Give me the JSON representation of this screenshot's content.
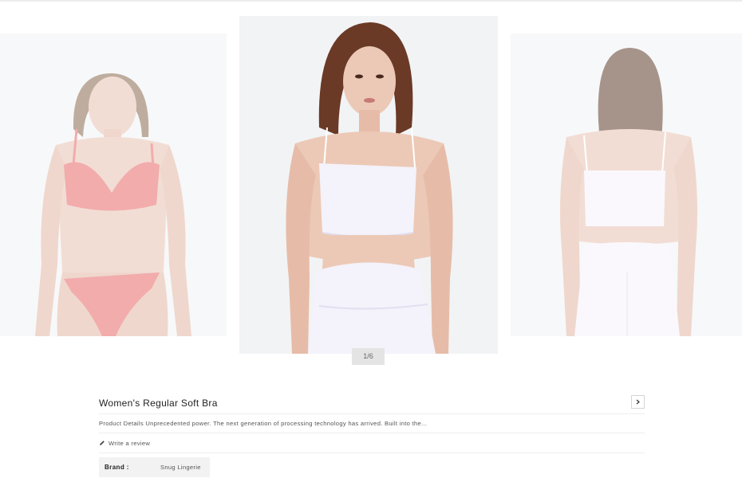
{
  "carousel": {
    "counter": "1/6",
    "slides": [
      {
        "position": "previous",
        "subject": "model in red lace bra and panty"
      },
      {
        "position": "current",
        "subject": "model in white tube bra and leggings"
      },
      {
        "position": "next",
        "subject": "back view of white tube bra and leggings"
      }
    ]
  },
  "product": {
    "title": "Women's Regular Soft Bra",
    "description": "Product Details Unprecedented power. The next generation of processing technology has arrived. Built into the...",
    "review_link": "Write a review",
    "brand_label": "Brand :",
    "brand_value": "Snug Lingerie"
  },
  "icons": {
    "next": "chevron-right-icon",
    "review": "pencil-icon"
  },
  "colors": {
    "slide_bg": "#f2f3f5",
    "red_lingerie": "#e86a6a",
    "white_garment": "#f4f2fa",
    "skin": "#e9c3b3",
    "counter_bg": "#e4e4e4"
  }
}
